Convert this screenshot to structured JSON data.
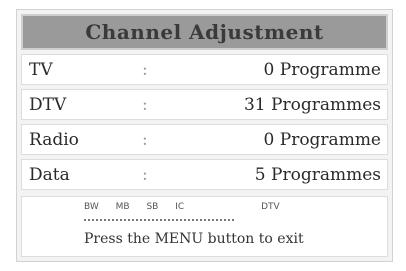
{
  "title": "Channel Adjustment",
  "rows": [
    {
      "label": "TV",
      "separator": ":",
      "value": "0 Programme"
    },
    {
      "label": "DTV",
      "separator": ":",
      "value": "31 Programmes"
    },
    {
      "label": "Radio",
      "separator": ":",
      "value": "0 Programme"
    },
    {
      "label": "Data",
      "separator": ":",
      "value": "5 Programmes"
    }
  ],
  "footer": {
    "hints": [
      "BW",
      "MB",
      "SB",
      "IC",
      "DTV"
    ],
    "exit_text": "Press the MENU button to exit"
  }
}
